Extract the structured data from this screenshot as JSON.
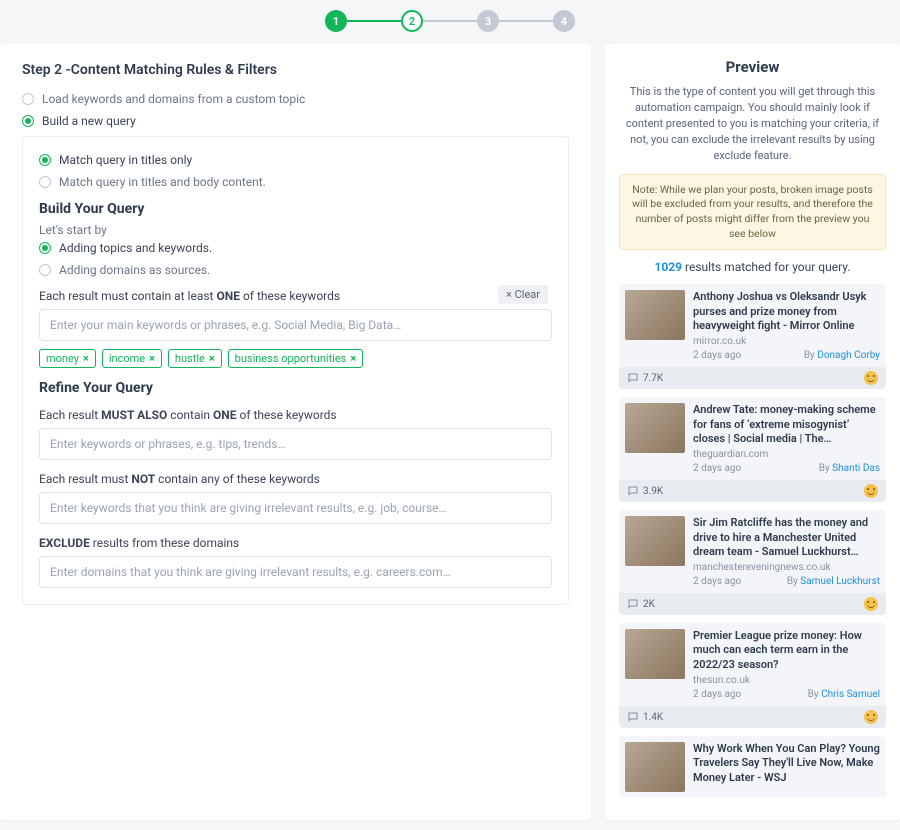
{
  "stepper": {
    "steps": [
      "1",
      "2",
      "3",
      "4"
    ],
    "active": 2
  },
  "left": {
    "title": "Step 2 -Content Matching Rules & Filters",
    "mode": {
      "load": "Load keywords and domains from a custom topic",
      "build": "Build a new query"
    },
    "matchScope": {
      "titles": "Match query in titles only",
      "body": "Match query in titles and body content."
    },
    "buildHeading": "Build Your Query",
    "letsStart": "Let's start by",
    "startOptions": {
      "topics": "Adding topics and keywords.",
      "domains": "Adding domains as sources."
    },
    "ruleOne_pre": "Each result must contain at least ",
    "ruleOne_bold": "ONE",
    "ruleOne_post": " of these keywords",
    "clear": "× Clear",
    "kwPlaceholder": "Enter your main keywords or phrases, e.g. Social Media, Big Data…",
    "tags": [
      "money",
      "income",
      "hustle",
      "business opportunities"
    ],
    "refineHeading": "Refine Your Query",
    "ruleAlso_pre": "Each result ",
    "ruleAlso_b1": "MUST ALSO",
    "ruleAlso_mid": " contain ",
    "ruleAlso_b2": "ONE",
    "ruleAlso_post": " of these keywords",
    "alsoPlaceholder": "Enter keywords or phrases, e.g. tips, trends…",
    "ruleNot_pre": "Each result must ",
    "ruleNot_bold": "NOT",
    "ruleNot_post": " contain any of these keywords",
    "notPlaceholder": "Enter keywords that you think are giving irrelevant results, e.g. job, course…",
    "ruleExcl_bold": "EXCLUDE",
    "ruleExcl_post": " results from these domains",
    "exclPlaceholder": "Enter domains that you think are giving irrelevant results, e.g. careers.com…"
  },
  "right": {
    "title": "Preview",
    "desc": "This is the type of content you will get through this automation campaign. You should mainly look if content presented to you is matching your criteria, if not, you can exclude the irrelevant results by using exclude feature.",
    "note": "Note: While we plan your posts, broken image posts will be excluded from your results, and therefore the number of posts might differ from the preview you see below",
    "count": "1029",
    "countLabel": " results matched for your query.",
    "byLabel": "By ",
    "results": [
      {
        "title": "Anthony Joshua vs Oleksandr Usyk purses and prize money from heavyweight fight - Mirror Online",
        "source": "mirror.co.uk",
        "age": "2 days ago",
        "author": "Donagh Corby",
        "eng": "7.7K"
      },
      {
        "title": "Andrew Tate: money-making scheme for fans of ‘extreme misogynist’ closes | Social media | The…",
        "source": "theguardian.com",
        "age": "2 days ago",
        "author": "Shanti Das",
        "eng": "3.9K"
      },
      {
        "title": "Sir Jim Ratcliffe has the money and drive to hire a Manchester United dream team - Samuel Luckhurst…",
        "source": "manchestereveningnews.co.uk",
        "age": "2 days ago",
        "author": "Samuel Luckhurst",
        "eng": "2K"
      },
      {
        "title": "Premier League prize money: How much can each term earn in the 2022/23 season?",
        "source": "thesun.co.uk",
        "age": "2 days ago",
        "author": "Chris Samuel",
        "eng": "1.4K"
      },
      {
        "title": "Why Work When You Can Play? Young Travelers Say They'll Live Now, Make Money Later - WSJ",
        "source": "",
        "age": "",
        "author": "",
        "eng": ""
      }
    ]
  }
}
